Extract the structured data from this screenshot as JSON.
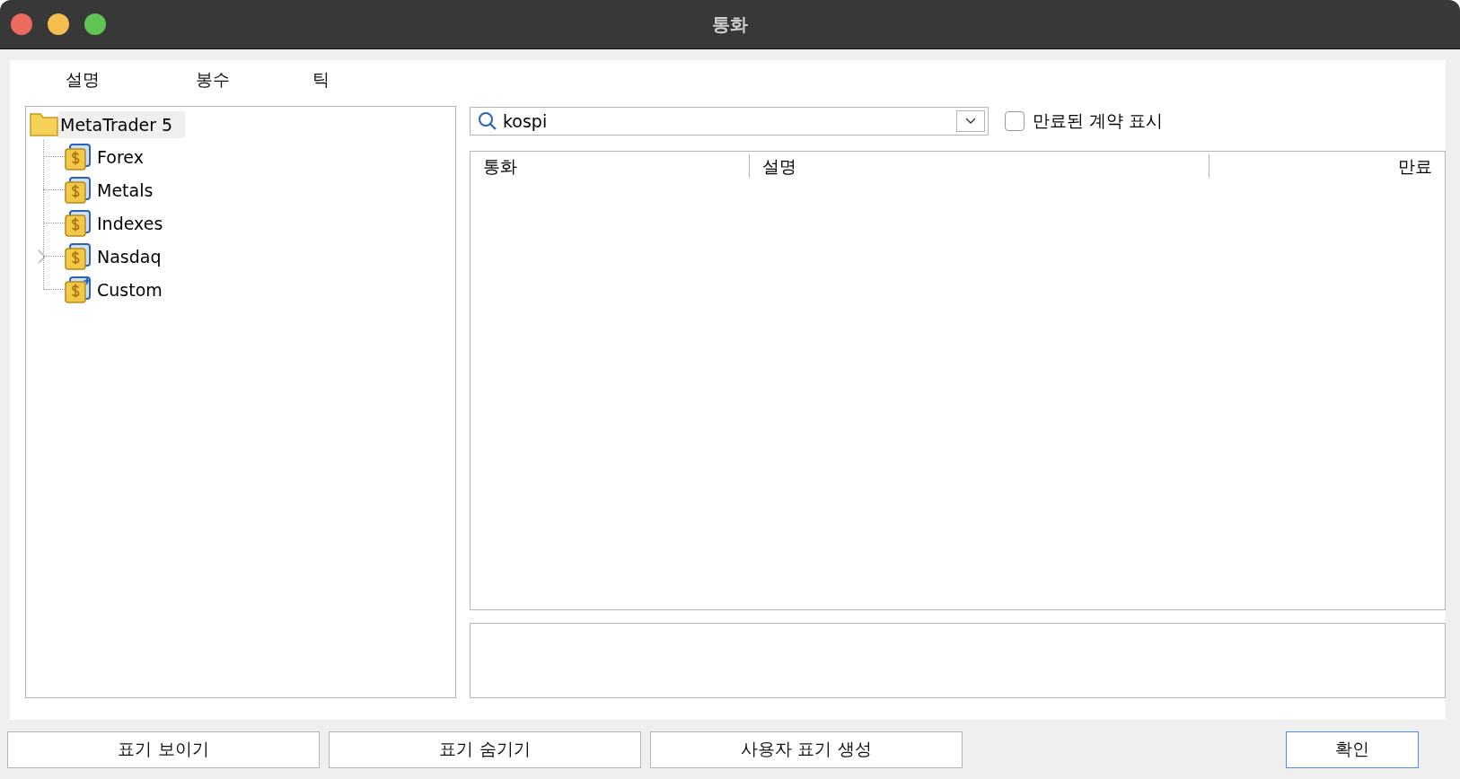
{
  "window": {
    "title": "통화"
  },
  "tabs": [
    "설명",
    "봉수",
    "틱"
  ],
  "tree": {
    "label": "MetaTrader 5",
    "selected": true,
    "expanded": true,
    "children": [
      {
        "label": "Forex",
        "kind": "symbols",
        "selected": false,
        "expandable": false
      },
      {
        "label": "Metals",
        "kind": "symbols",
        "selected": false,
        "expandable": false
      },
      {
        "label": "Indexes",
        "kind": "symbols",
        "selected": false,
        "expandable": false
      },
      {
        "label": "Nasdaq",
        "kind": "symbols",
        "selected": false,
        "expandable": true
      },
      {
        "label": "Custom",
        "kind": "custom",
        "selected": false,
        "expandable": false
      }
    ]
  },
  "search": {
    "value": "kospi"
  },
  "expired_checkbox": {
    "label": "만료된 계약 표시",
    "checked": false
  },
  "table": {
    "columns": [
      "통화",
      "설명",
      "만료"
    ]
  },
  "buttons": [
    {
      "label": "표기 보이기",
      "primary": false
    },
    {
      "label": "표기 숨기기",
      "primary": false
    },
    {
      "label": "사용자 표기 생성",
      "primary": false
    },
    {
      "label": "확인",
      "primary": true
    }
  ]
}
